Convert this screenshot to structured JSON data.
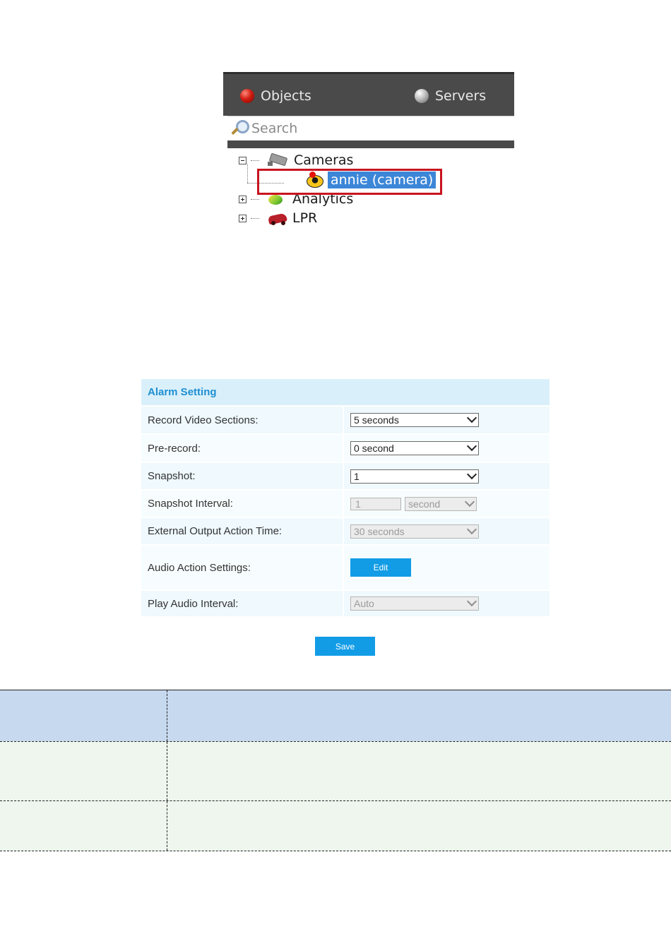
{
  "object_tree": {
    "tabs": [
      {
        "label": "Objects"
      },
      {
        "label": "Servers"
      }
    ],
    "search": {
      "placeholder": "Search"
    },
    "nodes": {
      "cameras": "Cameras",
      "camera_item": "annie (camera)",
      "analytics": "Analytics",
      "lpr": "LPR"
    },
    "highlight_color": "#c8141f"
  },
  "alarm_setting": {
    "title": "Alarm Setting",
    "rows": {
      "record_video_sections": {
        "label": "Record Video Sections:",
        "value": "5 seconds"
      },
      "pre_record": {
        "label": "Pre-record:",
        "value": "0 second"
      },
      "snapshot": {
        "label": "Snapshot:",
        "value": "1"
      },
      "snapshot_interval": {
        "label": "Snapshot Interval:",
        "value": "1",
        "unit": "second"
      },
      "external_output_action_time": {
        "label": "External Output Action Time:",
        "value": "30 seconds"
      },
      "audio_action_settings": {
        "label": "Audio Action Settings:",
        "button": "Edit"
      },
      "play_audio_interval": {
        "label": "Play Audio Interval:",
        "value": "Auto"
      }
    },
    "save_label": "Save",
    "accent_color": "#129ce6"
  },
  "bottom_table": {
    "header_color": "#c7d9ef",
    "row_color": "#eef6ee"
  }
}
